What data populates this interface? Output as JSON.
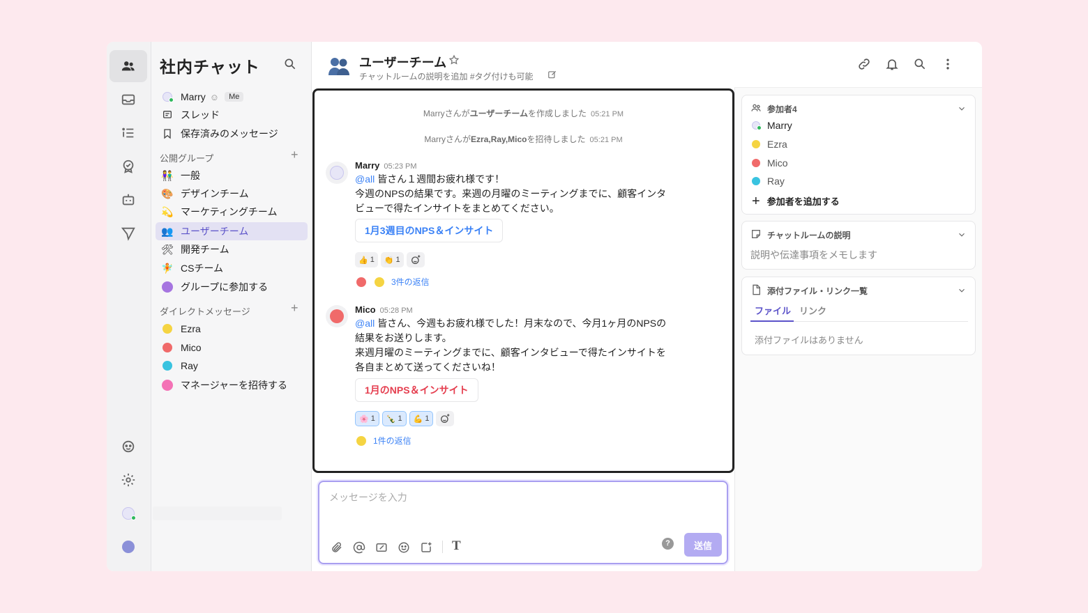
{
  "sidebar": {
    "title": "社内チャット",
    "me": {
      "name": "Marry",
      "badge": "Me"
    },
    "threads": "スレッド",
    "saved": "保存済みのメッセージ",
    "public_groups_label": "公開グループ",
    "groups": [
      {
        "label": "一般",
        "icon": "people-emoji"
      },
      {
        "label": "デザインチーム",
        "icon": "palette-emoji"
      },
      {
        "label": "マーケティングチーム",
        "icon": "sparkle-emoji"
      },
      {
        "label": "ユーザーチーム",
        "icon": "users-emoji"
      },
      {
        "label": "開発チーム",
        "icon": "tools-emoji"
      },
      {
        "label": "CSチーム",
        "icon": "fairy-emoji"
      },
      {
        "label": "グループに参加する",
        "icon": "unicorn-emoji"
      }
    ],
    "dm_label": "ダイレクトメッセージ",
    "dms": [
      {
        "label": "Ezra",
        "color": "#f5d442"
      },
      {
        "label": "Mico",
        "color": "#f06a6a"
      },
      {
        "label": "Ray",
        "color": "#39c3e0"
      }
    ],
    "invite": "マネージャーを招待する"
  },
  "room": {
    "title": "ユーザーチーム",
    "description": "チャットルームの説明を追加 #タグ付けも可能"
  },
  "system_messages": [
    {
      "pre": "Marryさんが",
      "bold": "ユーザーチーム",
      "post": "を作成しました",
      "time": "05:21 PM"
    },
    {
      "pre": "Marryさんが",
      "bold": "Ezra,Ray,Mico",
      "post": "を招待しました",
      "time": "05:21 PM"
    }
  ],
  "messages": [
    {
      "author": "Marry",
      "time": "05:23 PM",
      "mention": "@all",
      "line1": " 皆さん１週間お疲れ様です！",
      "line2": "今週のNPSの結果です。来週の月曜のミーティングまでに、顧客インタ",
      "line3": "ビューで得たインサイトをまとめてください。",
      "attachment": "1月3週目のNPS＆インサイト",
      "attachment_color": "#3b82f6",
      "reactions": [
        {
          "emoji": "👍",
          "count": "1"
        },
        {
          "emoji": "👏",
          "count": "1"
        }
      ],
      "reply": "3件の返信"
    },
    {
      "author": "Mico",
      "time": "05:28 PM",
      "mention": "@all",
      "line1": " 皆さん、今週もお疲れ様でした！月末なので、今月1ヶ月のNPSの",
      "line2": "結果をお送りします。",
      "line3": "来週月曜のミーティングまでに、顧客インタビューで得たインサイトを",
      "line4": "各自まとめて送ってくださいね！",
      "attachment": "1月のNPS＆インサイト",
      "attachment_color": "#e53e4f",
      "reactions": [
        {
          "emoji": "🌸",
          "count": "1"
        },
        {
          "emoji": "🍾",
          "count": "1"
        },
        {
          "emoji": "💪",
          "count": "1"
        }
      ],
      "reply": "1件の返信"
    }
  ],
  "composer": {
    "placeholder": "メッセージを入力",
    "send": "送信",
    "help": "?"
  },
  "right": {
    "participants_label": "参加者4",
    "participants": [
      {
        "name": "Marry",
        "color": "#8b90d8"
      },
      {
        "name": "Ezra",
        "color": "#f5d442"
      },
      {
        "name": "Mico",
        "color": "#f06a6a"
      },
      {
        "name": "Ray",
        "color": "#39c3e0"
      }
    ],
    "add_participant": "参加者を追加する",
    "desc_label": "チャットルームの説明",
    "desc_placeholder": "説明や伝達事項をメモします",
    "files_label": "添付ファイル・リンク一覧",
    "tab_files": "ファイル",
    "tab_links": "リンク",
    "no_files": "添付ファイルはありません"
  },
  "colors": {
    "accent": "#5b52c9",
    "send": "#b3abf2",
    "mention": "#3b82f6"
  }
}
